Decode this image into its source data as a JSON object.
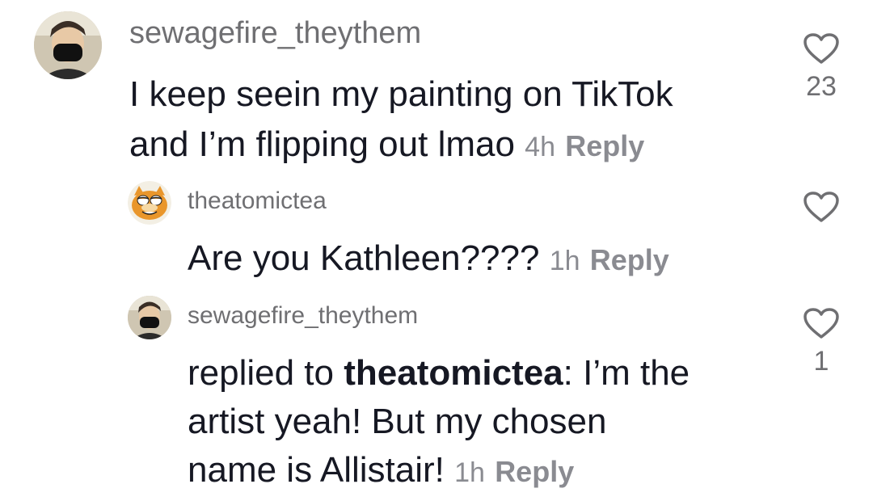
{
  "comments": [
    {
      "username": "sewagefire_theythem",
      "line1": "I keep seein my painting on TikTok",
      "line2": "and I’m flipping out lmao",
      "time": "4h",
      "reply_label": "Reply",
      "likes": "23",
      "avatar_icon": "masked-person-avatar"
    },
    {
      "username": "theatomictea",
      "text": "Are you Kathleen????",
      "time": "1h",
      "reply_label": "Reply",
      "likes": "",
      "avatar_icon": "cartoon-cat-avatar"
    },
    {
      "username": "sewagefire_theythem",
      "prefix": "replied to ",
      "mention": "theatomictea",
      "line1_rest": ": I’m the",
      "line2": "artist yeah! But my chosen",
      "line3": "name is Allistair!",
      "time": "1h",
      "reply_label": "Reply",
      "likes": "1",
      "avatar_icon": "masked-person-avatar"
    }
  ],
  "colors": {
    "text": "#161823",
    "muted": "#8a8b91",
    "username": "#6f6f72"
  }
}
